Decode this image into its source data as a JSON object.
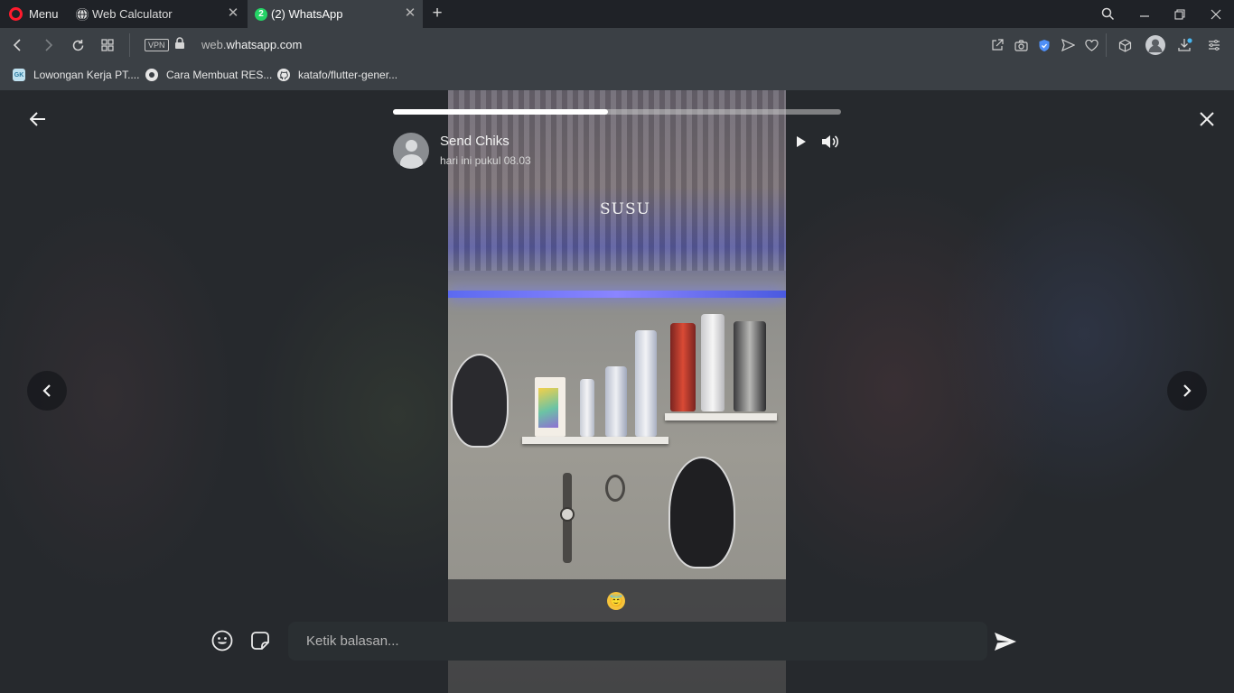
{
  "browser": {
    "menu_label": "Menu",
    "tabs": [
      {
        "title": "Web Calculator",
        "active": false
      },
      {
        "title": "(2) WhatsApp",
        "badge": "2",
        "active": true
      }
    ],
    "address": {
      "vpn_label": "VPN",
      "url_prefix": "web.",
      "url_domain": "whatsapp.com"
    },
    "bookmarks": [
      {
        "label": "Lowongan Kerja PT....",
        "icon_text": "GK"
      },
      {
        "label": "Cara Membuat RES...",
        "icon_text": ""
      },
      {
        "label": "katafo/flutter-gener...",
        "icon_text": ""
      }
    ],
    "accent_color": "#ff1b2d",
    "whatsapp_color": "#25d366"
  },
  "status_viewer": {
    "progress": 0.48,
    "contact_name": "Send Chiks",
    "posted_time": "hari ini pukul 08.03",
    "image_text": "SUSU",
    "caption_emoji": "😇",
    "reply": {
      "value": "",
      "placeholder": "Ketik balasan..."
    }
  }
}
